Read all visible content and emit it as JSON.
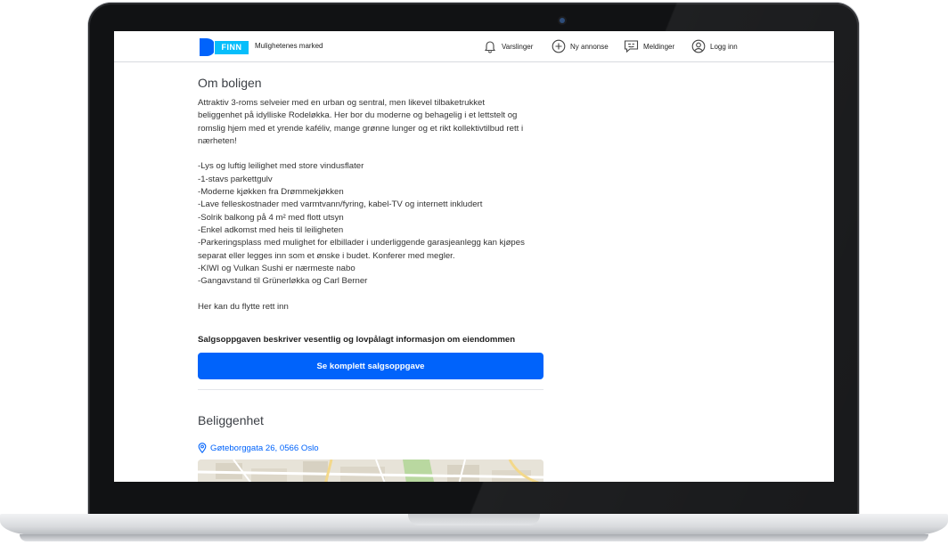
{
  "header": {
    "logo_text": "FINN",
    "tagline": "Mulighetenes marked",
    "nav": [
      {
        "label": "Varslinger",
        "icon": "bell-icon"
      },
      {
        "label": "Ny annonse",
        "icon": "plus-circle-icon"
      },
      {
        "label": "Meldinger",
        "icon": "chat-icon"
      },
      {
        "label": "Logg inn",
        "icon": "user-icon"
      }
    ]
  },
  "about": {
    "title": "Om boligen",
    "intro": [
      "Attraktiv 3-roms selveier med en urban og sentral, men likevel tilbaketrukket",
      "beliggenhet på idylliske Rodeløkka.  Her bor du moderne og behagelig i et lettstelt og",
      "romslig hjem med et yrende kaféliv, mange grønne lunger og et rikt kollektivtilbud rett i",
      "nærheten!"
    ],
    "bullets": [
      "-Lys og luftig leilighet med store vindusflater",
      "-1-stavs parkettgulv",
      "-Moderne kjøkken fra Drømmekjøkken",
      "-Lave felleskostnader med varmtvann/fyring, kabel-TV og internett inkludert",
      "-Solrik balkong på 4 m² med flott utsyn",
      "-Enkel adkomst med heis til leiligheten",
      "-Parkeringsplass med mulighet for elbillader i underliggende garasjeanlegg kan kjøpes",
      "separat eller legges inn som et ønske i budet. Konferer med megler.",
      "-KIWI og Vulkan Sushi er nærmeste nabo",
      "-Gangavstand til Grünerløkka og Carl Berner"
    ],
    "closing": "Her kan du flytte rett inn"
  },
  "sales": {
    "legal_text": "Salgsoppgaven beskriver vesentlig og lovpålagt informasjon om eiendommen",
    "button_label": "Se komplett salgsoppgave"
  },
  "location": {
    "title": "Beliggenhet",
    "address": "Gøteborggata 26, 0566 Oslo"
  },
  "colors": {
    "primary": "#0063fb",
    "logo_light": "#06befb",
    "text": "#333333"
  }
}
